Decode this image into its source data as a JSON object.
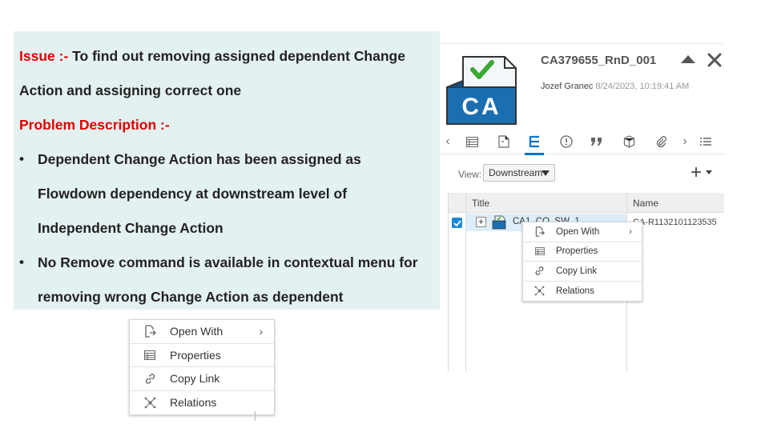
{
  "issue_panel": {
    "issue_label": "Issue :-",
    "issue_text": " To find out removing assigned dependent Change",
    "issue_text_2": "Action and assigning correct one",
    "problem_label": "Problem Description :-",
    "bullet_glyph": "•",
    "bullets": [
      {
        "line1": "Dependent Change Action has been assigned as",
        "line2": "Flowdown dependency at downstream level of",
        "line3": "Independent Change Action"
      },
      {
        "line1": "No Remove command is available in contextual menu for",
        "line2": "removing wrong Change Action as dependent"
      }
    ]
  },
  "context_menu": {
    "items": [
      {
        "label": "Open With",
        "icon": "open-with-icon",
        "has_submenu": true
      },
      {
        "label": "Properties",
        "icon": "properties-icon"
      },
      {
        "label": "Copy Link",
        "icon": "link-icon"
      },
      {
        "label": "Relations",
        "icon": "relations-icon"
      }
    ],
    "submenu_arrow": "›"
  },
  "app": {
    "object_icon_text": "CA",
    "title": "CA379655_RnD_001",
    "owner": "Jozef Granec",
    "date": "8/24/2023, 10:19:41 AM",
    "view_label": "View:",
    "view_value": "Downstream",
    "add_symbol": "+",
    "toolbar_left": "‹",
    "toolbar_right": "›",
    "columns": {
      "title": "Title",
      "name": "Name"
    },
    "row": {
      "expand_symbol": "+",
      "title": "CA1_CO_SW_1",
      "name": "CA-R1132101123535",
      "checked": true
    }
  },
  "colors": {
    "accent": "#0a74c4",
    "issue_red": "#e00000",
    "panel_bg": "#e4f1f1",
    "check_blue": "#1a8ad6",
    "ca_icon_blue": "#1b6fb0",
    "check_green": "#3aa935"
  }
}
